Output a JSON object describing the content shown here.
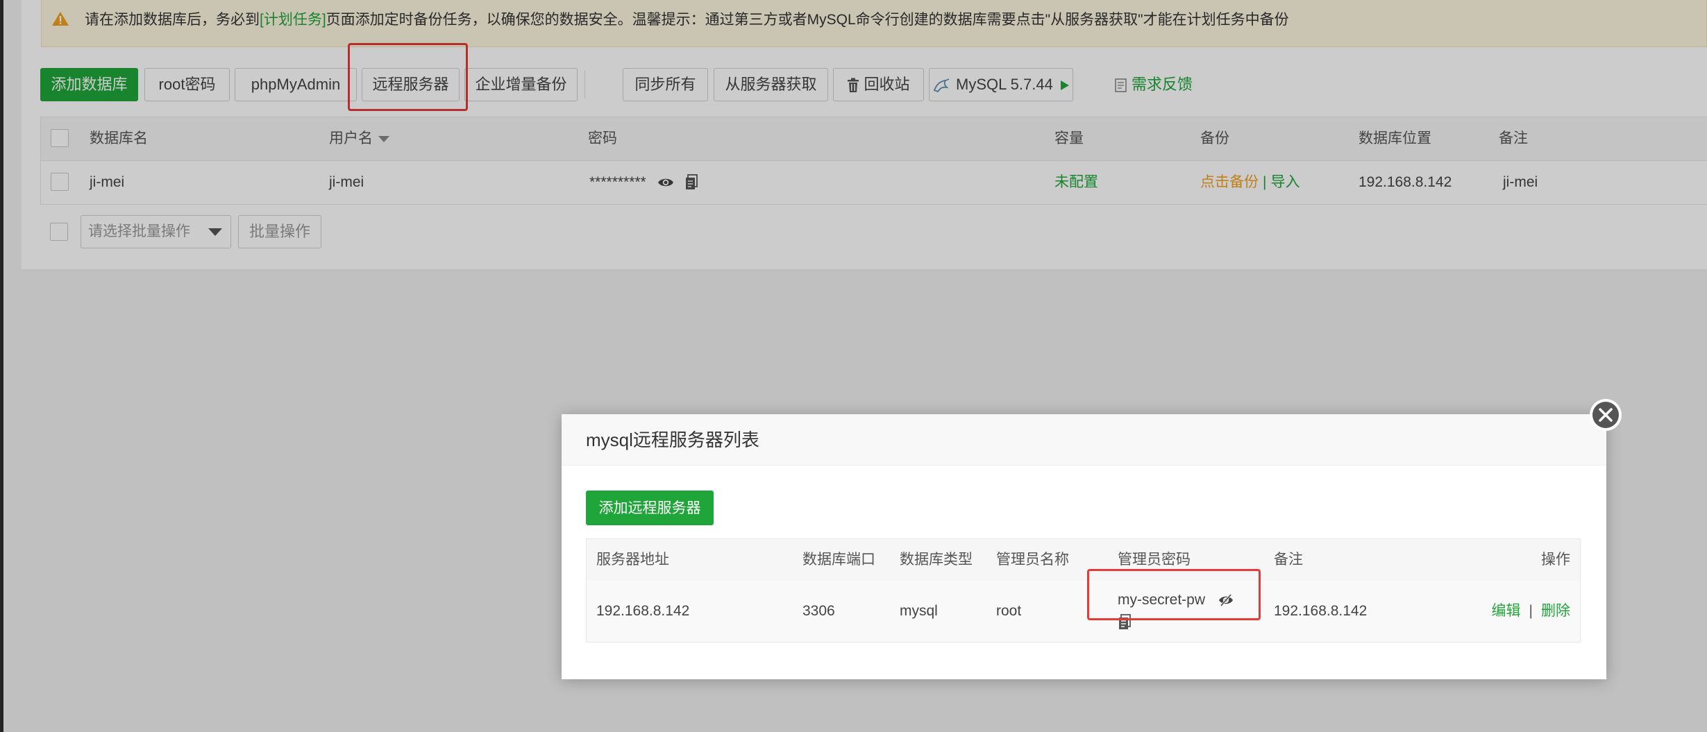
{
  "alert": {
    "text_before": "请在添加数据库后，务必到",
    "link": "[计划任务]",
    "text_after": "页面添加定时备份任务，以确保您的数据安全。温馨提示：通过第三方或者MySQL命令行创建的数据库需要点击\"从服务器获取\"才能在计划任务中备份"
  },
  "toolbar": {
    "add_db": "添加数据库",
    "root_password": "root密码",
    "phpmyadmin": "phpMyAdmin",
    "remote_server": "远程服务器",
    "enterprise_backup": "企业增量备份",
    "sync_all": "同步所有",
    "fetch_from_server": "从服务器获取",
    "recycle_bin": "回收站",
    "mysql_version": "MySQL 5.7.44",
    "feedback": "需求反馈"
  },
  "db_table": {
    "headers": {
      "name": "数据库名",
      "username": "用户名",
      "password": "密码",
      "capacity": "容量",
      "backup": "备份",
      "location": "数据库位置",
      "remark": "备注"
    },
    "rows": [
      {
        "name": "ji-mei",
        "username": "ji-mei",
        "password": "**********",
        "capacity": "未配置",
        "backup_link": "点击备份",
        "backup_sep": "|",
        "import_link": "导入",
        "location": "192.168.8.142",
        "remark": "ji-mei"
      }
    ]
  },
  "batch": {
    "placeholder": "请选择批量操作",
    "button": "批量操作"
  },
  "dialog": {
    "title": "mysql远程服务器列表",
    "add_button": "添加远程服务器",
    "headers": {
      "address": "服务器地址",
      "port": "数据库端口",
      "type": "数据库类型",
      "admin_name": "管理员名称",
      "admin_password": "管理员密码",
      "remark": "备注",
      "actions": "操作"
    },
    "rows": [
      {
        "address": "192.168.8.142",
        "port": "3306",
        "type": "mysql",
        "admin_name": "root",
        "admin_password": "my-secret-pw",
        "remark": "192.168.8.142",
        "edit": "编辑",
        "sep": "|",
        "delete": "删除"
      }
    ]
  },
  "colors": {
    "brand_green": "#20a53a",
    "warning_orange": "#f0a020",
    "highlight_red": "#e63a3a"
  }
}
